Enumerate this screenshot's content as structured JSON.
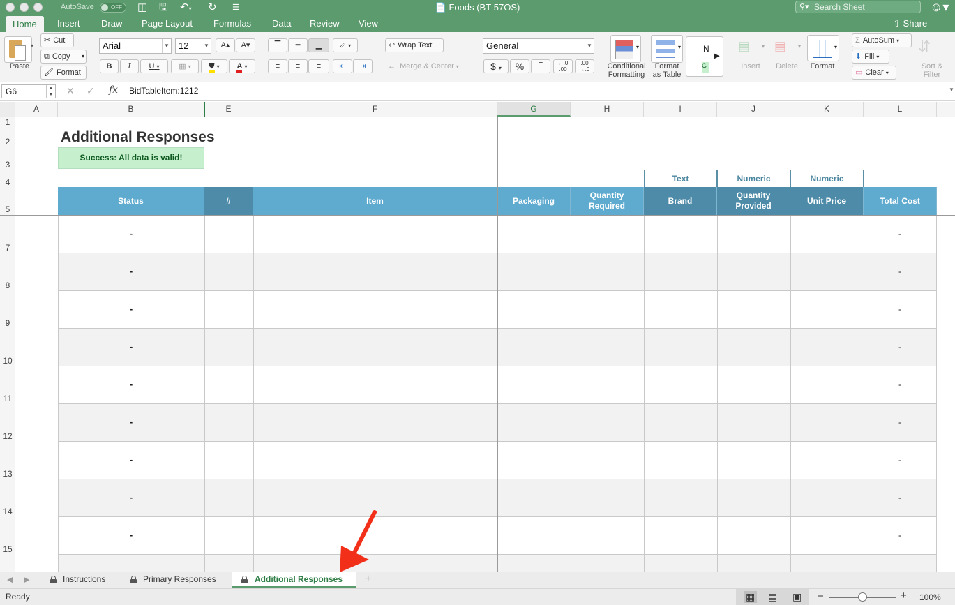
{
  "titlebar": {
    "autosave_label": "AutoSave",
    "autosave_state": "OFF",
    "document_title": "Foods (BT-57OS)",
    "search_placeholder": "Search Sheet"
  },
  "ribbon_tabs": [
    "Home",
    "Insert",
    "Draw",
    "Page Layout",
    "Formulas",
    "Data",
    "Review",
    "View"
  ],
  "share_label": "Share",
  "ribbon": {
    "paste": "Paste",
    "cut": "Cut",
    "copy": "Copy",
    "format_painter": "Format",
    "font_name": "Arial",
    "font_size": "12",
    "wrap_text": "Wrap Text",
    "merge_center": "Merge & Center",
    "number_format": "General",
    "conditional_formatting": "Conditional\nFormatting",
    "format_as_table": "Format\nas Table",
    "styles_preview": "N",
    "styles_preview_green": "G",
    "insert": "Insert",
    "delete": "Delete",
    "format": "Format",
    "autosum": "AutoSum",
    "fill": "Fill",
    "clear": "Clear",
    "sort_filter": "Sort &\nFilter"
  },
  "formula_bar": {
    "name_box": "G6",
    "formula": "BidTableItem:1212"
  },
  "columns": [
    "A",
    "B",
    "E",
    "F",
    "G",
    "H",
    "I",
    "J",
    "K",
    "L"
  ],
  "selected_column": "G",
  "rows": [
    "1",
    "2",
    "3",
    "4",
    "5",
    "7",
    "8",
    "9",
    "10",
    "11",
    "12",
    "13",
    "14",
    "15"
  ],
  "sheet": {
    "title": "Additional Responses",
    "validation_message": "Success: All data is valid!",
    "type_labels": [
      "Text",
      "Numeric",
      "Numeric"
    ],
    "headers": [
      "Status",
      "#",
      "Item",
      "Packaging",
      "Quantity\nRequired",
      "Brand",
      "Quantity\nProvided",
      "Unit Price",
      "Total Cost"
    ],
    "row_status": [
      "-",
      "-",
      "-",
      "-",
      "-",
      "-",
      "-",
      "-",
      "-"
    ],
    "row_total": [
      "-",
      "-",
      "-",
      "-",
      "-",
      "-",
      "-",
      "-",
      "-"
    ]
  },
  "sheet_tabs": [
    "Instructions",
    "Primary Responses",
    "Additional Responses"
  ],
  "active_sheet": "Additional Responses",
  "status_bar": {
    "ready": "Ready",
    "zoom": "100%"
  },
  "colors": {
    "excel_green": "#5b9b6e",
    "header_light_blue": "#5faacf",
    "header_dark_blue": "#4d8ba8",
    "success_fill": "#c6efce",
    "arrow_red": "#f2301a"
  }
}
